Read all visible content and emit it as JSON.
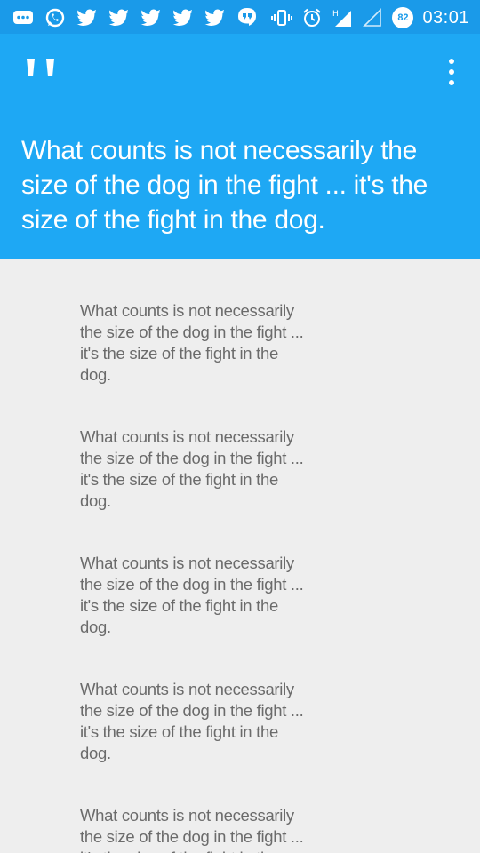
{
  "status_bar": {
    "left_icons": [
      "message-icon",
      "whatsapp-icon",
      "twitter-icon",
      "twitter-icon",
      "twitter-icon",
      "twitter-icon",
      "twitter-icon",
      "hangouts-icon"
    ],
    "right_icons": [
      "vibrate-icon",
      "alarm-icon",
      "signal-h-icon",
      "signal-empty-icon"
    ],
    "battery": "82",
    "time": "03:01"
  },
  "header": {
    "quote": "What counts is not necessarily the size of the dog in the fight ... it's the size of the fight in the dog."
  },
  "list": {
    "items": [
      "What counts is not necessarily the size of the dog in the fight ... it's the size of the fight in the dog.",
      "What counts is not necessarily the size of the dog in the fight ... it's the size of the fight in the dog.",
      "What counts is not necessarily the size of the dog in the fight ... it's the size of the fight in the dog.",
      "What counts is not necessarily the size of the dog in the fight ... it's the size of the fight in the dog.",
      "What counts is not necessarily the size of the dog in the fight ... it's the size of the fight in the dog."
    ]
  },
  "colors": {
    "status_bar": "#1a9ae9",
    "header": "#1ea8f4",
    "background": "#eeeeee",
    "list_text": "#6b6b6b"
  }
}
